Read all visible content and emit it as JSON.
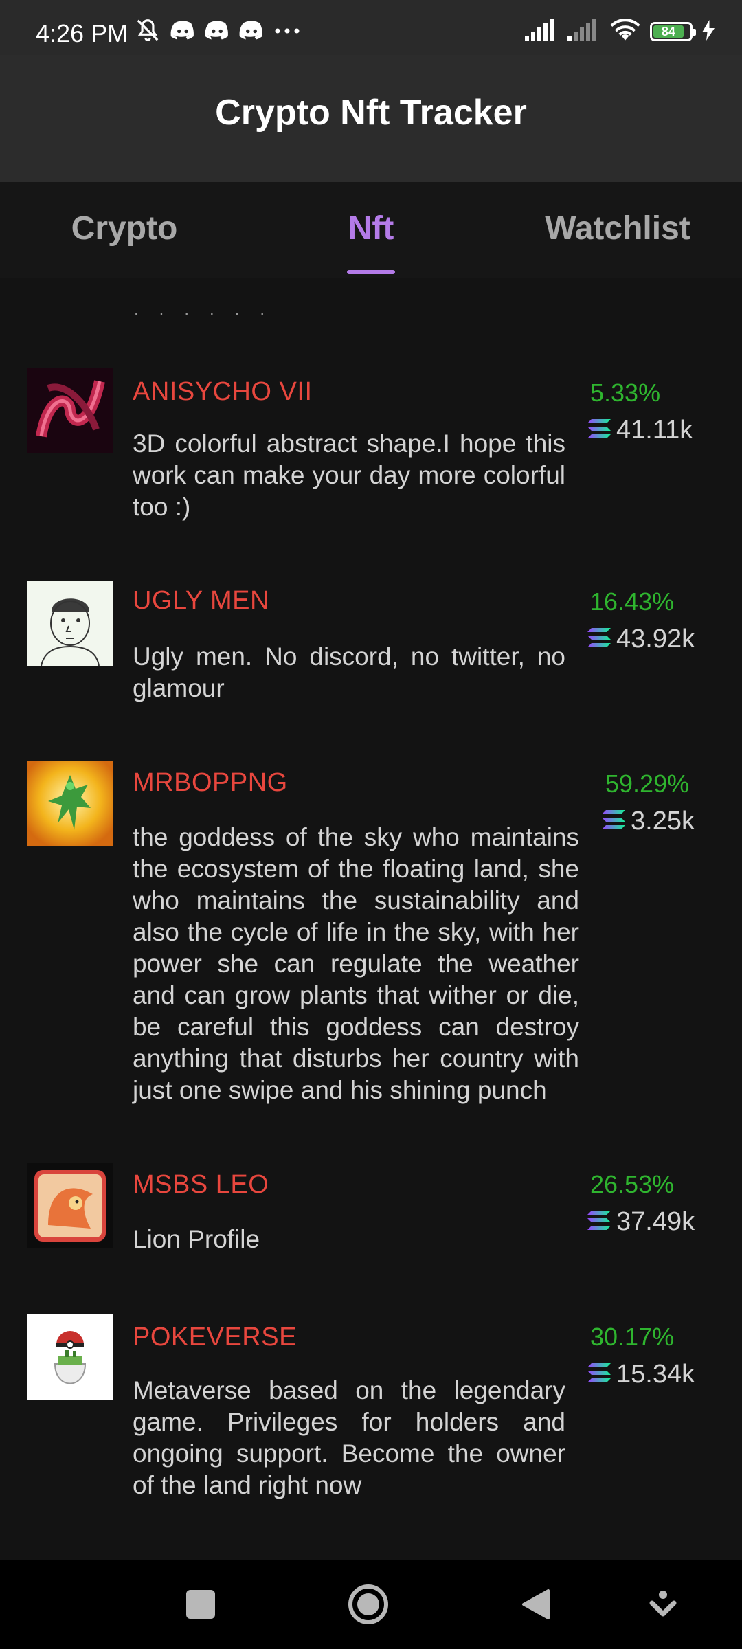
{
  "status_bar": {
    "time": "4:26 PM",
    "battery_level": "84",
    "icons_left": [
      "silent-icon",
      "discord-icon",
      "discord-icon",
      "discord-icon",
      "more-dots-icon"
    ],
    "icons_right": [
      "signal-icon",
      "signal-weak-icon",
      "wifi-icon",
      "battery-icon",
      "charging-icon"
    ]
  },
  "app": {
    "title": "Crypto Nft Tracker"
  },
  "tabs": [
    {
      "label": "Crypto",
      "active": false
    },
    {
      "label": "Nft",
      "active": true
    },
    {
      "label": "Watchlist",
      "active": false
    }
  ],
  "colors": {
    "accent": "#b47be8",
    "name": "#e8473e",
    "positive": "#2fb52f",
    "text": "#d4d4d4",
    "background": "#131313"
  },
  "nft_list": [
    {
      "name": "ANISYCHO VII",
      "description": "3D colorful abstract shape.I hope this work can make your day more colorful too :)",
      "change": "5.33%",
      "volume": "41.11k",
      "currency_icon": "solana-icon"
    },
    {
      "name": "UGLY MEN",
      "description": "Ugly men. No discord, no twitter, no glamour",
      "change": "16.43%",
      "volume": "43.92k",
      "currency_icon": "solana-icon"
    },
    {
      "name": "MRBOPPNG",
      "description": "the goddess of the sky who maintains the ecosystem of the floating land, she who maintains the sustainability and also the cycle of life in the sky, with her power she can regulate the weather and can grow plants that wither or die, be careful this goddess can destroy anything that disturbs her country with just one swipe and his shining punch",
      "change": "59.29%",
      "volume": "3.25k",
      "currency_icon": "solana-icon"
    },
    {
      "name": "MSBS LEO",
      "description": "Lion Profile",
      "change": "26.53%",
      "volume": "37.49k",
      "currency_icon": "solana-icon"
    },
    {
      "name": "POKEVERSE",
      "description": "Metaverse based on the legendary game. Privileges for holders and ongoing support. Become the owner of the land right now",
      "change": "30.17%",
      "volume": "15.34k",
      "currency_icon": "solana-icon"
    }
  ],
  "nav_bar": [
    "recents-square-icon",
    "home-circle-icon",
    "back-triangle-icon",
    "menu-down-icon"
  ]
}
